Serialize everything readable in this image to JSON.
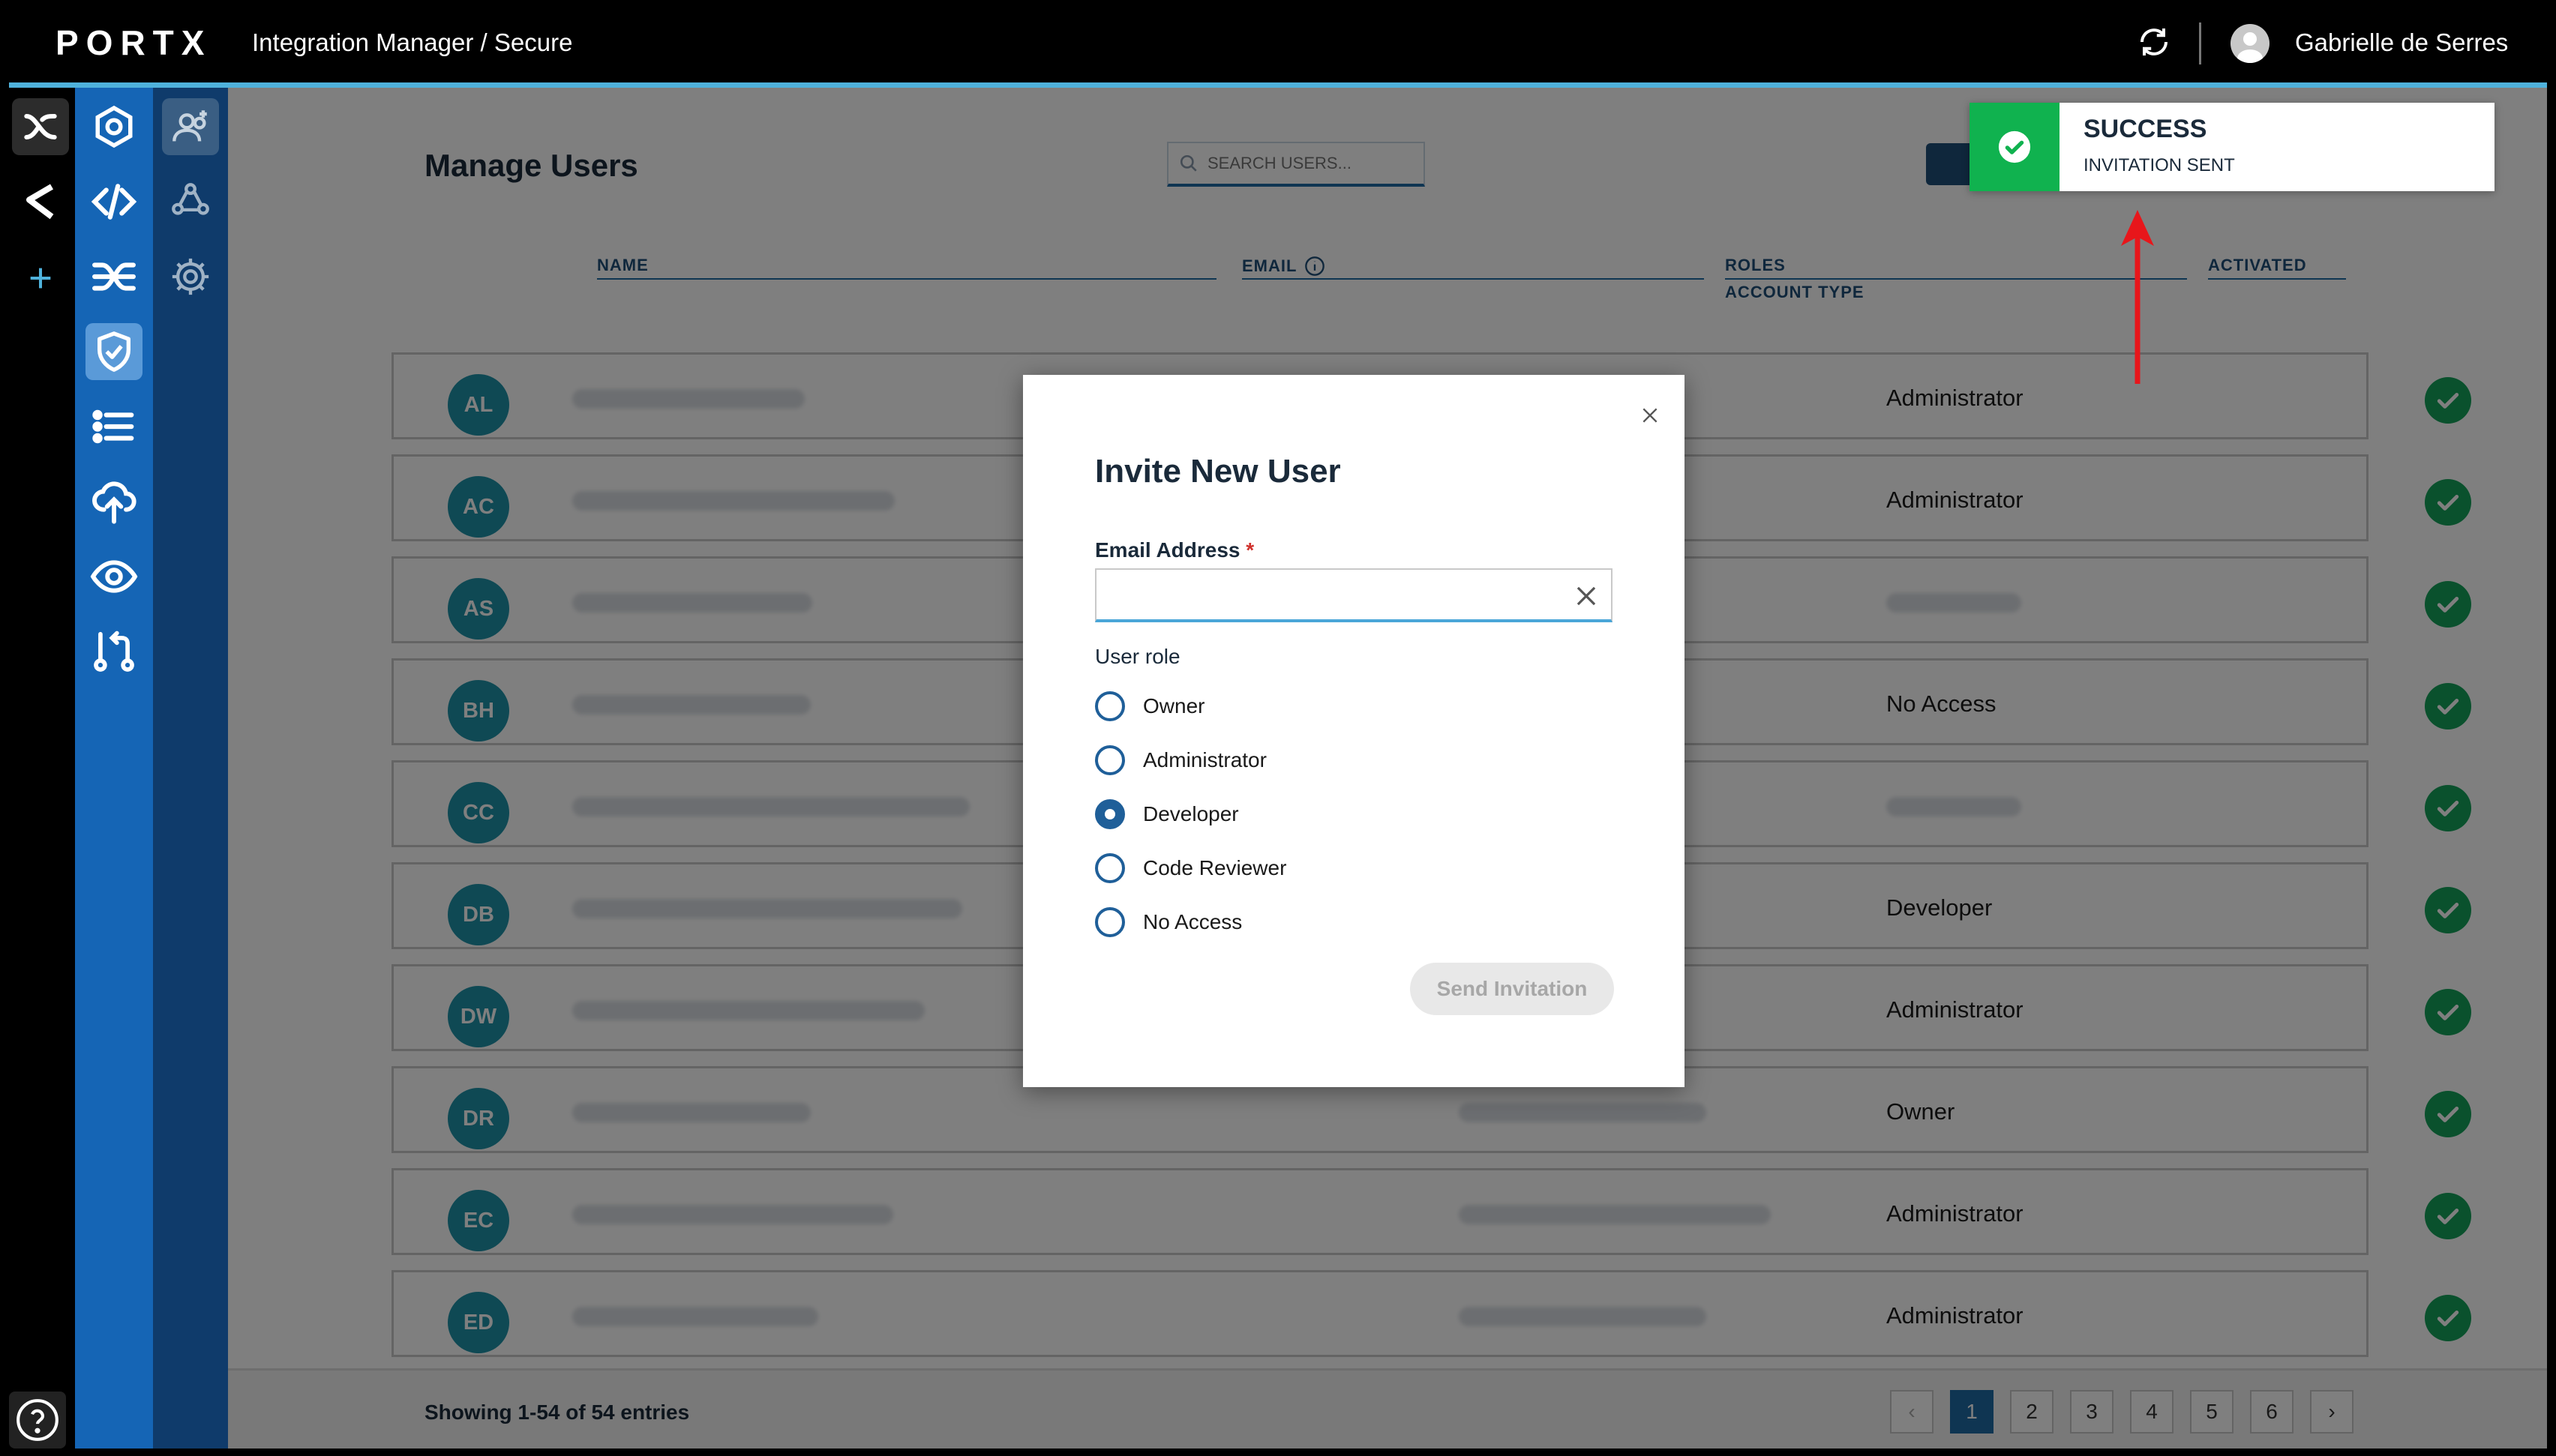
{
  "header": {
    "logo": "PORTX",
    "breadcrumb": "Integration Manager / Secure",
    "user_name": "Gabrielle de Serres",
    "icons": [
      "refresh-icon",
      "avatar"
    ]
  },
  "rail": {
    "items": [
      "portx-home-icon",
      "curved-c-icon",
      "plus-icon"
    ],
    "help_icon": "question-circle-icon"
  },
  "sidebar": {
    "items": [
      "hexagon-icon",
      "code-icon",
      "shuffle-icon",
      "shield-check-icon",
      "list-icon",
      "cloud-upload-icon",
      "eye-icon",
      "pull-request-icon"
    ],
    "active": "shield-check-icon"
  },
  "subbar": {
    "items": [
      "add-user-icon",
      "network-icon",
      "gear-icon"
    ],
    "active": "add-user-icon"
  },
  "page": {
    "title": "Manage Users",
    "search_placeholder": "SEARCH USERS..."
  },
  "table": {
    "columns": {
      "name": "NAME",
      "email": "EMAIL",
      "roles": "ROLES",
      "account_type": "ACCOUNT TYPE",
      "activated": "ACTIVATED"
    },
    "rows": [
      {
        "initials": "AL",
        "role": "Administrator",
        "activated": true
      },
      {
        "initials": "AC",
        "role": "Administrator",
        "activated": true
      },
      {
        "initials": "AS",
        "role": "",
        "activated": true
      },
      {
        "initials": "BH",
        "role": "No Access",
        "activated": true
      },
      {
        "initials": "CC",
        "role": "",
        "activated": true
      },
      {
        "initials": "DB",
        "role": "Developer",
        "activated": true
      },
      {
        "initials": "DW",
        "role": "Administrator",
        "activated": true
      },
      {
        "initials": "DR",
        "role": "Owner",
        "activated": true
      },
      {
        "initials": "EC",
        "role": "Administrator",
        "activated": true
      },
      {
        "initials": "ED",
        "role": "Administrator",
        "activated": true
      }
    ]
  },
  "footer": {
    "showing": "Showing 1-54 of 54 entries",
    "pages": [
      "1",
      "2",
      "3",
      "4",
      "5",
      "6"
    ],
    "prev": "‹",
    "next": "›"
  },
  "modal": {
    "title": "Invite New User",
    "email_label": "Email Address",
    "required_mark": "*",
    "email_value": "",
    "role_label": "User role",
    "roles": [
      "Owner",
      "Administrator",
      "Developer",
      "Code Reviewer",
      "No Access"
    ],
    "selected_role": "Developer",
    "send_label": "Send Invitation"
  },
  "toast": {
    "title": "SUCCESS",
    "message": "INVITATION SENT",
    "color": "#10b24f"
  },
  "colors": {
    "accent": "#1565b5",
    "success": "#14a35b",
    "avatar": "#1f92a8"
  }
}
